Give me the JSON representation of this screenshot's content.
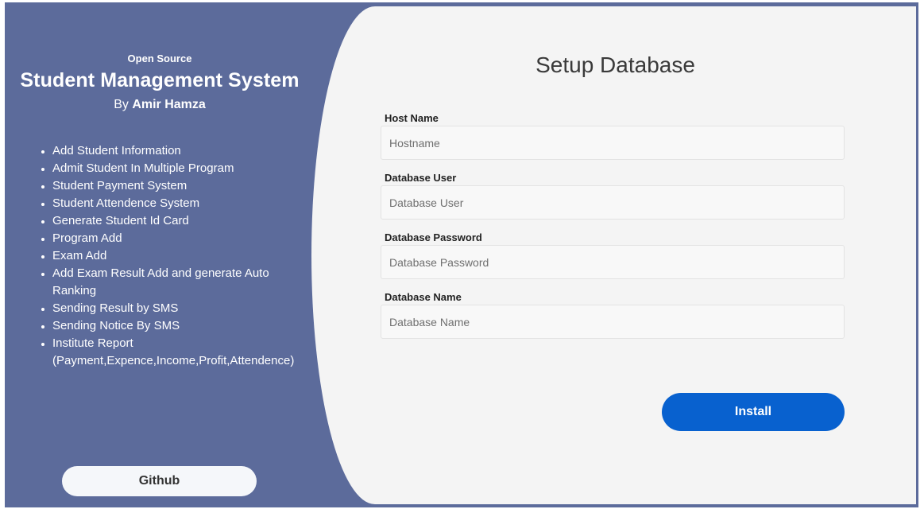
{
  "sidebar": {
    "eyebrow": "Open Source",
    "title": "Student Management System",
    "by_prefix": "By ",
    "author": "Amir Hamza",
    "features": [
      "Add Student Information",
      "Admit Student In Multiple Program",
      "Student Payment System",
      "Student Attendence System",
      "Generate Student Id Card",
      "Program Add",
      "Exam Add",
      "Add Exam Result Add and generate Auto Ranking",
      "Sending Result by SMS",
      "Sending Notice By SMS",
      "Institute Report (Payment,Expence,Income,Profit,Attendence)"
    ],
    "github_label": "Github"
  },
  "form": {
    "title": "Setup Database",
    "fields": [
      {
        "label": "Host Name",
        "placeholder": "Hostname",
        "value": ""
      },
      {
        "label": "Database User",
        "placeholder": "Database User",
        "value": ""
      },
      {
        "label": "Database Password",
        "placeholder": "Database Password",
        "value": ""
      },
      {
        "label": "Database Name",
        "placeholder": "Database Name",
        "value": ""
      }
    ],
    "install_label": "Install"
  },
  "colors": {
    "sidebar_bg": "#5c6b9b",
    "panel_bg": "#f4f4f4",
    "accent": "#0861cf"
  }
}
